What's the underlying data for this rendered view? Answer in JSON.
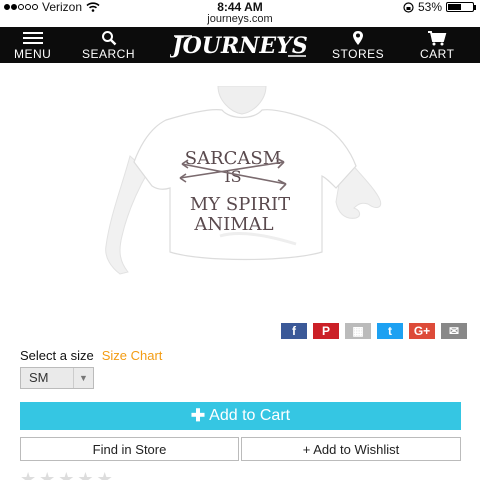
{
  "status": {
    "carrier": "Verizon",
    "time": "8:44 AM",
    "battery_pct": "53%",
    "battery_level": 0.53,
    "signal_dots_filled": 2,
    "signal_dots_total": 5
  },
  "browser": {
    "url": "journeys.com"
  },
  "nav": {
    "menu_label": "MENU",
    "search_label": "SEARCH",
    "brand": "JOURNEYS",
    "stores_label": "STORES",
    "cart_label": "CART"
  },
  "product": {
    "shirt_text": [
      "SARCASM",
      "IS",
      "MY SPIRIT",
      "ANIMAL"
    ]
  },
  "share": [
    {
      "icon": "facebook-icon",
      "glyph": "f",
      "color": "#3b5998"
    },
    {
      "icon": "pinterest-icon",
      "glyph": "P",
      "color": "#cb2027"
    },
    {
      "icon": "grid-icon",
      "glyph": "▦",
      "color": "#bbbbbb"
    },
    {
      "icon": "twitter-icon",
      "glyph": "t",
      "color": "#1da1f2"
    },
    {
      "icon": "google-plus-icon",
      "glyph": "G+",
      "color": "#dd4b39"
    },
    {
      "icon": "email-icon",
      "glyph": "✉",
      "color": "#888888"
    }
  ],
  "size": {
    "label": "Select a size",
    "chart_link": "Size Chart",
    "selected": "SM"
  },
  "actions": {
    "add_to_cart": "Add to Cart",
    "find_in_store": "Find in Store",
    "add_to_wishlist": "+ Add to Wishlist"
  },
  "colors": {
    "accent": "#35c6e3",
    "size_chart": "#f39c12",
    "nav_bg": "#0c0c0c"
  }
}
